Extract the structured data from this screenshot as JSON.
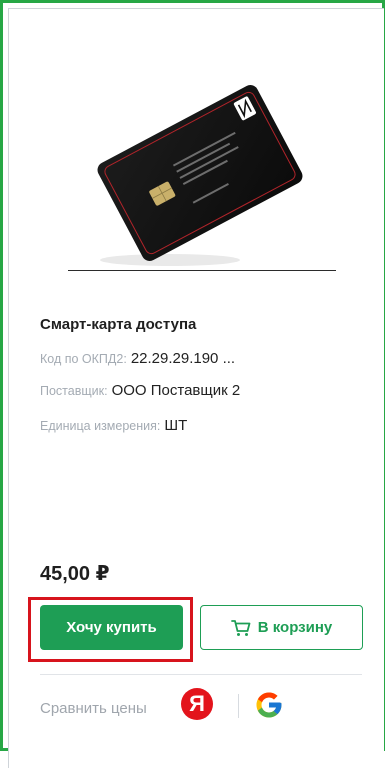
{
  "product": {
    "name": "Смарт-карта доступа",
    "okpd_label": "Код по ОКПД2:",
    "okpd_value": "22.29.29.190 ...",
    "supplier_label": "Поставщик:",
    "supplier_value": "ООО Поставщик 2",
    "unit_label": "Единица измерения:",
    "unit_value": "ШТ",
    "price": "45,00 ₽"
  },
  "actions": {
    "buy_label": "Хочу купить",
    "cart_label": "В корзину"
  },
  "compare": {
    "label": "Сравнить цены",
    "yandex_letter": "Я"
  },
  "colors": {
    "frame_green": "#27a745",
    "brand_green": "#1e9e55",
    "highlight_red": "#d7141d"
  }
}
